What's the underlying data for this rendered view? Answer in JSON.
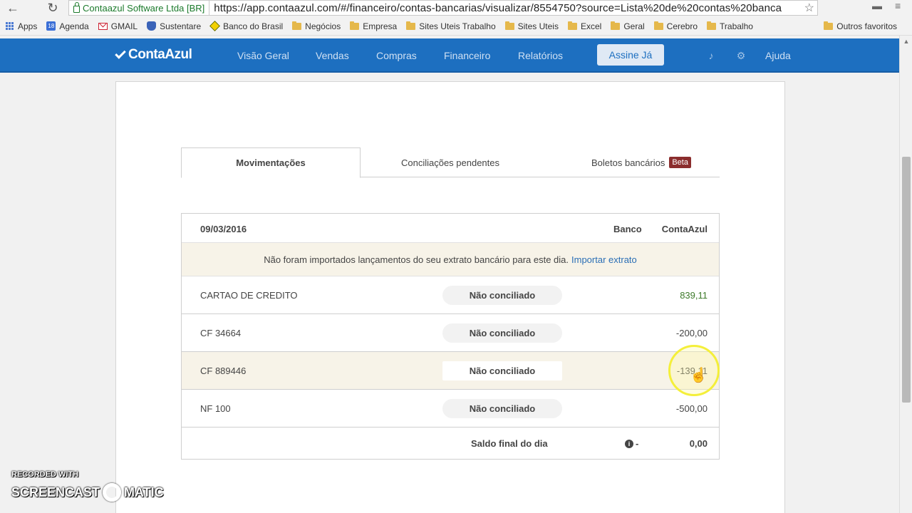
{
  "browser": {
    "back_label": "←",
    "reload_label": "↻",
    "site_identity": "Contaazul Software Ltda [BR]",
    "url": "https://app.contaazul.com/#/financeiro/contas-bancarias/visualizar/8554750?source=Lista%20de%20contas%20banca",
    "bookmarks": [
      {
        "label": "Apps",
        "icon": "apps-grid-icon"
      },
      {
        "label": "Agenda",
        "icon": "calendar-icon"
      },
      {
        "label": "GMAIL",
        "icon": "gmail-icon"
      },
      {
        "label": "Sustentare",
        "icon": "sustentare-icon"
      },
      {
        "label": "Banco do Brasil",
        "icon": "banco-brasil-icon"
      },
      {
        "label": "Negócios",
        "icon": "folder-icon"
      },
      {
        "label": "Empresa",
        "icon": "folder-icon"
      },
      {
        "label": "Sites Uteis Trabalho",
        "icon": "folder-icon"
      },
      {
        "label": "Sites Uteis",
        "icon": "folder-icon"
      },
      {
        "label": "Excel",
        "icon": "folder-icon"
      },
      {
        "label": "Geral",
        "icon": "folder-icon"
      },
      {
        "label": "Cerebro",
        "icon": "folder-icon"
      },
      {
        "label": "Trabalho",
        "icon": "folder-icon"
      }
    ],
    "other_bookmarks": "Outros favoritos"
  },
  "header": {
    "logo": "ContaAzul",
    "menu": [
      "Visão Geral",
      "Vendas",
      "Compras",
      "Financeiro",
      "Relatórios"
    ],
    "cta": "Assine Já",
    "help": "Ajuda"
  },
  "tabs": [
    {
      "label": "Movimentações",
      "active": true
    },
    {
      "label": "Conciliações pendentes",
      "active": false
    },
    {
      "label": "Boletos bancários",
      "active": false,
      "badge": "Beta"
    }
  ],
  "table": {
    "date": "09/03/2016",
    "col_bank": "Banco",
    "col_app": "ContaAzul",
    "notice_text": "Não foram importados lançamentos do seu extrato bancário para este dia.",
    "notice_link": "Importar extrato",
    "rows": [
      {
        "desc": "CARTAO DE CREDITO",
        "status": "Não conciliado",
        "amount": "839,11"
      },
      {
        "desc": "CF 34664",
        "status": "Não conciliado",
        "amount": "-200,00"
      },
      {
        "desc": "CF 889446",
        "status": "Não conciliado",
        "amount": "-139,11"
      },
      {
        "desc": "NF 100",
        "status": "Não conciliado",
        "amount": "-500,00"
      }
    ],
    "footer_label": "Saldo final do dia",
    "footer_bank": "-",
    "footer_app": "0,00"
  },
  "watermark": {
    "line1": "RECORDED WITH",
    "line2a": "SCREENCAST",
    "line2b": "MATIC"
  },
  "colors": {
    "header_bg": "#1d6fc0",
    "positive_amount": "#3d7a2a",
    "beta_badge": "#8b2d2d"
  }
}
